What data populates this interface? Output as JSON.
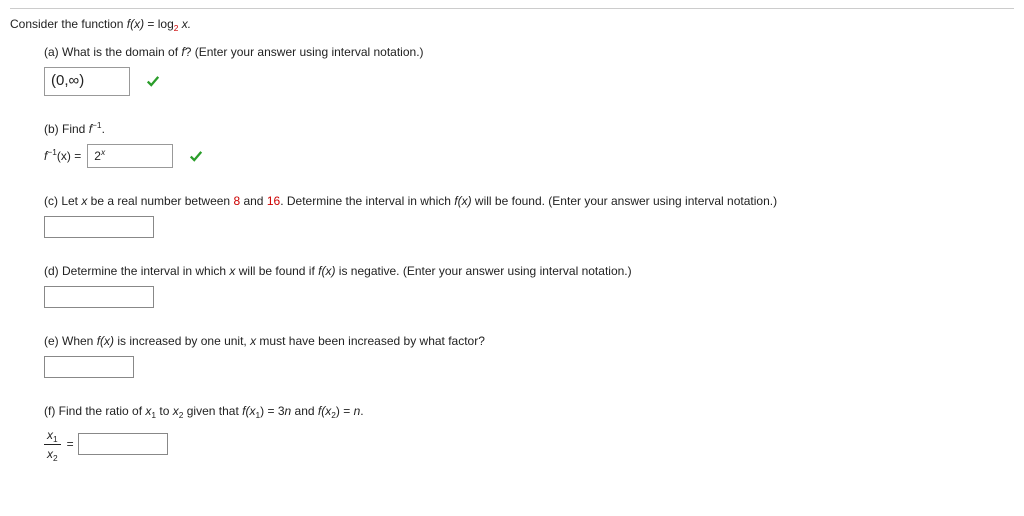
{
  "intro": {
    "prefix": "Consider the function  ",
    "fx": "f(x)",
    "equals": " = log",
    "base": "2",
    "arg": " x."
  },
  "a": {
    "prompt_prefix": "(a) What is the domain of ",
    "f": "f",
    "prompt_suffix": "? (Enter your answer using interval notation.)",
    "answer": "(0,∞)"
  },
  "b": {
    "prompt_prefix": "(b) Find  ",
    "sym": "f",
    "exp": "−1",
    "prompt_suffix": ".",
    "label_f": "f",
    "label_exp": "−1",
    "label_x": "(x)",
    "equals": " = ",
    "answer_base": "2",
    "answer_exp": "x"
  },
  "c": {
    "prefix": "(c) Let ",
    "x": "x",
    "p2": " be a real number between ",
    "n1": "8",
    "and": " and ",
    "n2": "16",
    "p3": ". Determine the interval in which  ",
    "fx": "f(x)",
    "p4": "  will be found. (Enter your answer using interval notation.)"
  },
  "d": {
    "prefix": "(d) Determine the interval in which ",
    "x": "x",
    "p2": " will be found if  ",
    "fx": "f(x)",
    "p3": "  is negative. (Enter your answer using interval notation.)"
  },
  "e": {
    "prefix": "(e) When  ",
    "fx": "f(x)",
    "p2": "  is increased by one unit, ",
    "x": "x",
    "p3": " must have been increased by what factor?"
  },
  "f": {
    "prefix": "(f) Find the ratio of  ",
    "x1": "x",
    "x1s": "1",
    "to": "  to  ",
    "x2": "x",
    "x2s": "2",
    "given": "  given that  ",
    "fx1": "f(x",
    "fx1s": "1",
    "fx1b": ")",
    "eq": " = 3",
    "n": "n",
    "and": "  and  ",
    "fx2": "f(x",
    "fx2s": "2",
    "fx2b": ")",
    "eq2": " = ",
    "n2": "n",
    "dot": ".",
    "frac_num_x": "x",
    "frac_num_s": "1",
    "frac_den_x": "x",
    "frac_den_s": "2",
    "equals": " = "
  }
}
